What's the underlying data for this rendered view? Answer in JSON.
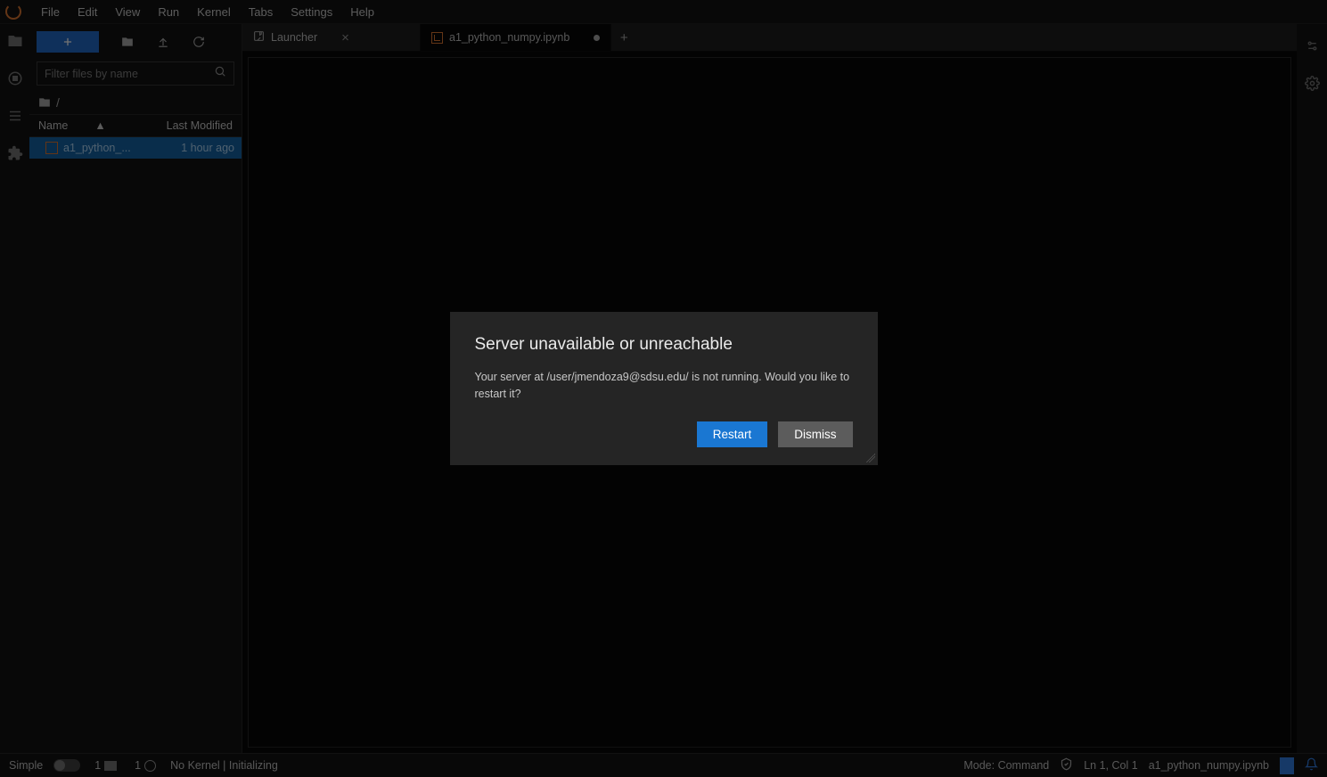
{
  "menu": {
    "items": [
      "File",
      "Edit",
      "View",
      "Run",
      "Kernel",
      "Tabs",
      "Settings",
      "Help"
    ]
  },
  "file_panel": {
    "filter_placeholder": "Filter files by name",
    "breadcrumb_root": "/",
    "header_name": "Name",
    "header_modified": "Last Modified",
    "files": [
      {
        "name": "a1_python_...",
        "modified": "1 hour ago"
      }
    ]
  },
  "tabs": {
    "launcher_label": "Launcher",
    "notebook_label": "a1_python_numpy.ipynb"
  },
  "dialog": {
    "title": "Server unavailable or unreachable",
    "body": "Your server at /user/jmendoza9@sdsu.edu/ is not running. Would you like to restart it?",
    "restart_label": "Restart",
    "dismiss_label": "Dismiss"
  },
  "statusbar": {
    "simple_label": "Simple",
    "count_left": "1",
    "count_left2": "1",
    "kernel_status": "No Kernel | Initializing",
    "mode_label": "Mode: Command",
    "cursor_label": "Ln 1, Col 1",
    "file_label": "a1_python_numpy.ipynb"
  }
}
